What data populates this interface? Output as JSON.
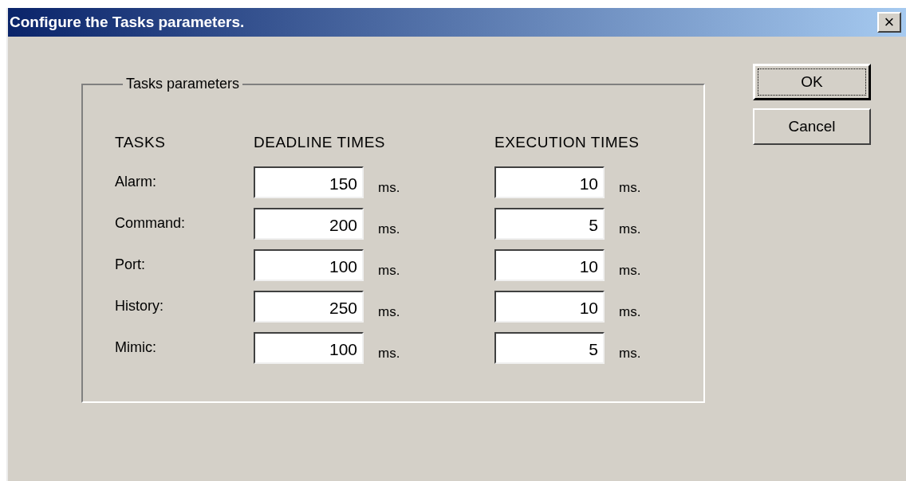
{
  "window": {
    "title": "Configure the Tasks parameters.",
    "close": "×"
  },
  "group": {
    "title": "Tasks parameters",
    "columns": [
      "TASKS",
      "DEADLINE TIMES",
      "EXECUTION TIMES"
    ],
    "rows": [
      {
        "task": "Alarm:",
        "deadline": "150",
        "deadline_unit": "ms.",
        "execution": "10",
        "execution_unit": "ms."
      },
      {
        "task": "Command:",
        "deadline": "200",
        "deadline_unit": "ms.",
        "execution": "5",
        "execution_unit": "ms."
      },
      {
        "task": "Port:",
        "deadline": "100",
        "deadline_unit": "ms.",
        "execution": "10",
        "execution_unit": "ms."
      },
      {
        "task": "History:",
        "deadline": "250",
        "deadline_unit": "ms.",
        "execution": "10",
        "execution_unit": "ms."
      },
      {
        "task": "Mimic:",
        "deadline": "100",
        "deadline_unit": "ms.",
        "execution": "5",
        "execution_unit": "ms."
      }
    ]
  },
  "buttons": [
    {
      "label": "OK",
      "focused": true
    },
    {
      "label": "Cancel",
      "focused": false
    }
  ]
}
